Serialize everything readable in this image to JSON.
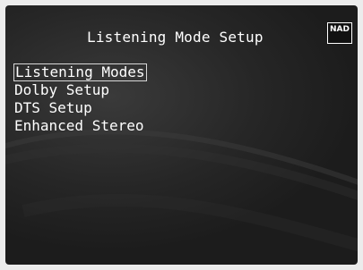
{
  "screen": {
    "title": "Listening Mode Setup",
    "logo": "NAD",
    "background_color": "#262626",
    "text_color": "#ffffff"
  },
  "menu": {
    "selected_index": 0,
    "items": [
      {
        "label": "Listening Modes"
      },
      {
        "label": "Dolby Setup"
      },
      {
        "label": "DTS Setup"
      },
      {
        "label": "Enhanced Stereo"
      }
    ]
  }
}
